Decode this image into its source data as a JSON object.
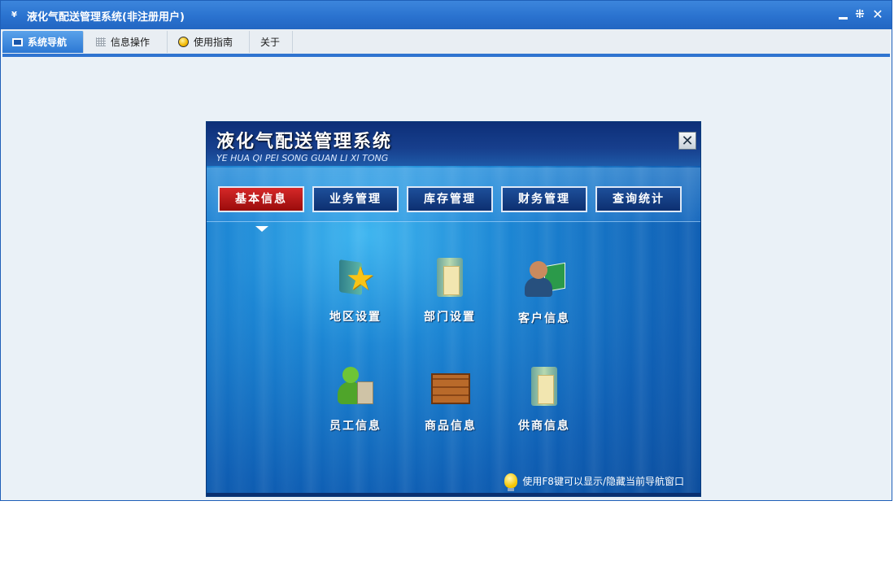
{
  "window": {
    "title": "液化气配送管理系统(非注册用户)",
    "logo_text": "¥",
    "controls": {
      "minimize": "minimize",
      "restore": "⁜",
      "close": "✕"
    }
  },
  "menubar": {
    "tabs": [
      {
        "label": "系统导航",
        "icon": "monitor-icon",
        "active": true
      },
      {
        "label": "信息操作",
        "icon": "grid-icon",
        "active": false
      },
      {
        "label": "使用指南",
        "icon": "compass-icon",
        "active": false
      },
      {
        "label": "关于",
        "icon": "",
        "active": false
      }
    ]
  },
  "nav": {
    "title": "液化气配送管理系统",
    "subtitle": "YE HUA QI PEI SONG GUAN LI XI TONG",
    "close_label": "✕",
    "buttons": [
      {
        "label": "基本信息",
        "active": true
      },
      {
        "label": "业务管理",
        "active": false
      },
      {
        "label": "库存管理",
        "active": false
      },
      {
        "label": "财务管理",
        "active": false
      },
      {
        "label": "查询统计",
        "active": false
      }
    ],
    "modules": [
      {
        "label": "地区设置",
        "icon": "folder-star-icon"
      },
      {
        "label": "部门设置",
        "icon": "folder-doc-icon"
      },
      {
        "label": "客户信息",
        "icon": "people-card-icon"
      },
      {
        "label": "员工信息",
        "icon": "person-bag-icon"
      },
      {
        "label": "商品信息",
        "icon": "crate-icon"
      },
      {
        "label": "供商信息",
        "icon": "folder-doc-icon"
      }
    ],
    "tip": "使用F8键可以显示/隐藏当前导航窗口"
  },
  "colors": {
    "titlebar": "#2a72cf",
    "nav_active": "#c41818",
    "nav_button": "#123a80"
  }
}
